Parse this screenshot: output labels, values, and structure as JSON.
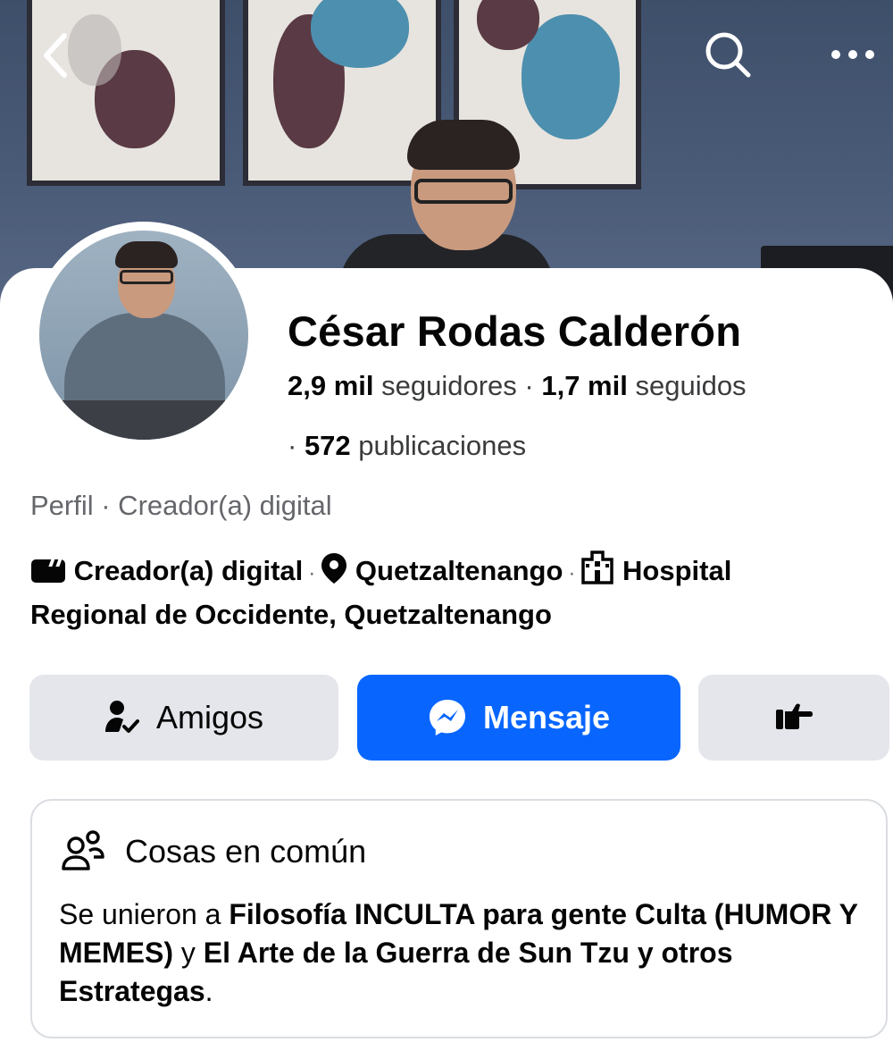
{
  "header": {
    "back_icon": "chevron-left-icon",
    "search_icon": "search-icon",
    "more_icon": "ellipsis-icon"
  },
  "profile": {
    "name": "César Rodas Calderón",
    "followers_count": "2,9 mil",
    "followers_label": "seguidores",
    "following_count": "1,7 mil",
    "following_label": "seguidos",
    "posts_count": "572",
    "posts_label": "publicaciones",
    "category_line": "Perfil · Creador(a) digital"
  },
  "details": {
    "creator": "Creador(a) digital",
    "location": "Quetzaltenango",
    "workplace": "Hospital Regional de Occidente, Quetzaltenango"
  },
  "actions": {
    "friends_label": "Amigos",
    "message_label": "Mensaje"
  },
  "common": {
    "title": "Cosas en común",
    "prefix": "Se unieron a",
    "group1": "Filosofía INCULTA para gente Culta (HUMOR Y MEMES)",
    "conjunction": "y",
    "group2": "El Arte de la Guerra de Sun Tzu y otros Estrategas",
    "suffix": "."
  },
  "colors": {
    "primary": "#0866ff",
    "button_gray": "#e4e6eb",
    "secondary_text": "#65676b"
  }
}
